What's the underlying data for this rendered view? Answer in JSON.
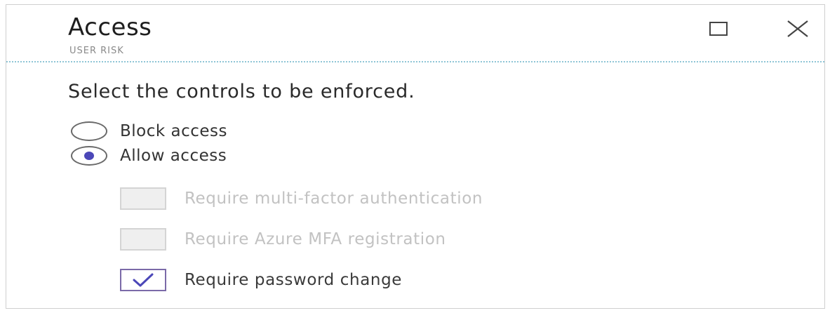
{
  "header": {
    "title": "Access",
    "subtitle": "USER RISK",
    "maximize_icon": "maximize-icon",
    "close_icon": "close-icon"
  },
  "body": {
    "instruction": "Select the controls to be enforced.",
    "radios": [
      {
        "label": "Block access",
        "selected": false
      },
      {
        "label": "Allow access",
        "selected": true
      }
    ],
    "checkboxes": [
      {
        "label": "Require multi-factor authentication",
        "checked": false,
        "enabled": false
      },
      {
        "label": "Require Azure MFA registration",
        "checked": false,
        "enabled": false
      },
      {
        "label": "Require password change",
        "checked": true,
        "enabled": true
      }
    ]
  },
  "colors": {
    "accent": "#4b47b8",
    "checkbox_border": "#7b6aa8",
    "divider": "#8fc6d6",
    "disabled_text": "#c2c2c2"
  }
}
